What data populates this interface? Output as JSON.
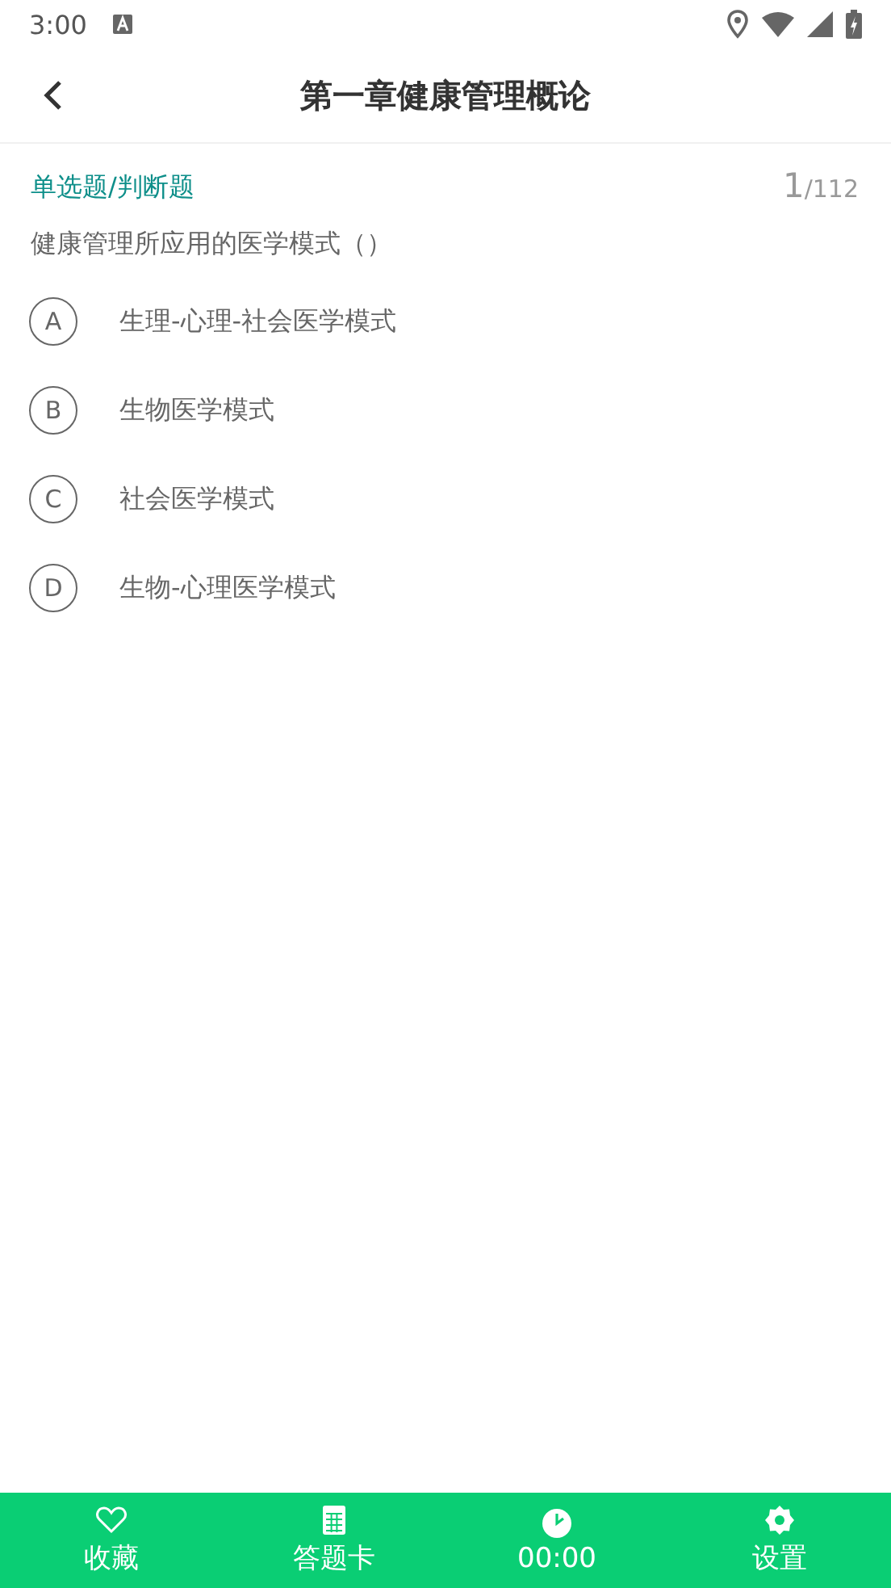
{
  "status_bar": {
    "time": "3:00"
  },
  "header": {
    "title": "第一章健康管理概论"
  },
  "question": {
    "type": "单选题/判断题",
    "current": "1",
    "total": "/112",
    "text": "健康管理所应用的医学模式（）",
    "options": [
      {
        "letter": "A",
        "text": "生理-心理-社会医学模式"
      },
      {
        "letter": "B",
        "text": "生物医学模式"
      },
      {
        "letter": "C",
        "text": "社会医学模式"
      },
      {
        "letter": "D",
        "text": "生物-心理医学模式"
      }
    ]
  },
  "bottom_bar": [
    {
      "kind": "heart",
      "label": "收藏"
    },
    {
      "kind": "grid",
      "label": "答题卡"
    },
    {
      "kind": "clock",
      "label": "00:00"
    },
    {
      "kind": "gear",
      "label": "设置"
    }
  ]
}
